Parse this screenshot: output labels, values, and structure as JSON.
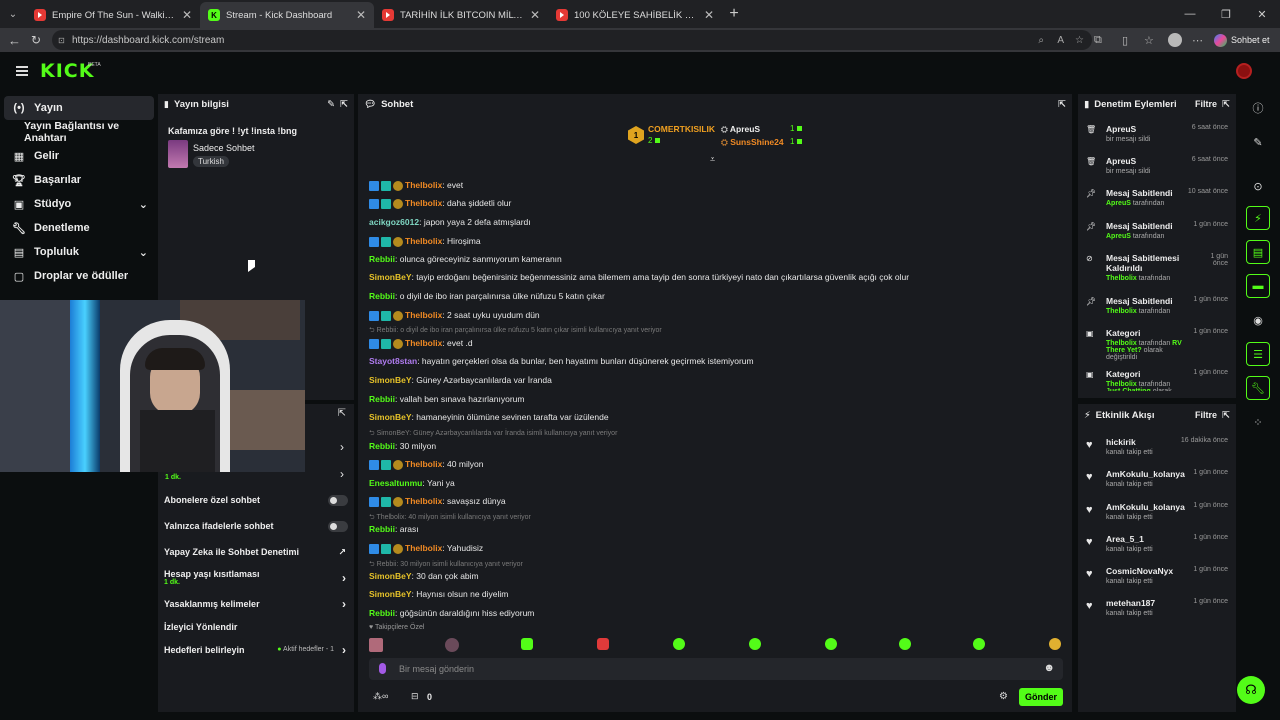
{
  "browser": {
    "tabs": [
      {
        "title": "Empire Of The Sun - Walking On A",
        "icon": "youtube-icon"
      },
      {
        "title": "Stream - Kick Dashboard",
        "icon": "kick-icon",
        "active": true
      },
      {
        "title": "TARİHİN İLK BITCOIN MİLYARDERİ",
        "icon": "youtube-icon"
      },
      {
        "title": "100 KÖLEYE SAHİBELİK YAPTIM! (S",
        "icon": "youtube-icon"
      }
    ],
    "url": "https://dashboard.kick.com/stream",
    "chat_btn": "Sohbet et"
  },
  "header": {
    "logo": "KICK",
    "beta": "BETA"
  },
  "sidebar": {
    "items": [
      {
        "label": "Yayın",
        "icon": "broadcast-icon"
      },
      {
        "label": "Yayın Bağlantısı ve Anahtarı",
        "icon": ""
      },
      {
        "label": "Gelir",
        "icon": "dashboard-icon"
      },
      {
        "label": "Başarılar",
        "icon": "trophy-icon"
      },
      {
        "label": "Stüdyo",
        "icon": "studio-icon"
      },
      {
        "label": "Denetleme",
        "icon": "wrench-icon"
      },
      {
        "label": "Topluluk",
        "icon": "community-icon"
      },
      {
        "label": "Droplar ve ödüller",
        "icon": "gift-icon"
      }
    ]
  },
  "stream_info": {
    "title": "Yayın bilgisi",
    "stream_title": "Kafamıza göre ! !yt !insta !bng",
    "category": "Sadece Sohbet",
    "language": "Turkish"
  },
  "chat_settings": {
    "time1": "1 dk.",
    "sub_only": "Abonelere özel sohbet",
    "emote_only": "Yalnızca ifadelerle sohbet",
    "ai_mod": "Yapay Zeka ile Sohbet Denetimi",
    "age": "Hesap yaşı kısıtlaması",
    "age_val": "1 dk.",
    "banned": "Yasaklanmış kelimeler",
    "raid": "İzleyici Yönlendir",
    "goals": "Hedefleri belirleyin",
    "goals_status": "Aktif hedefler - 1"
  },
  "chat": {
    "title": "Sohbet",
    "leader1": {
      "name": "COMERTKISILIK",
      "count": "2",
      "rank": "1"
    },
    "leader2": {
      "name": "ApreuS",
      "count": "1"
    },
    "leader3": {
      "name": "SunsShine24",
      "count": "1"
    },
    "followers_label": "Takipçilere Özel",
    "placeholder": "Bir mesaj gönderin",
    "send": "Gönder",
    "points": "0",
    "messages": [
      {
        "user": "Thelbolix",
        "color": "#f08a24",
        "text": "evet",
        "badges": true
      },
      {
        "user": "Thelbolix",
        "color": "#f08a24",
        "text": "daha şiddetli olur",
        "badges": true
      },
      {
        "user": "acikgoz6012",
        "color": "#7fd6c2",
        "text": "japon yaya 2 defa atmışlardı",
        "badges": false
      },
      {
        "user": "Thelbolix",
        "color": "#f08a24",
        "text": "Hiroşima",
        "badges": true
      },
      {
        "user": "Rebbii",
        "color": "#53fc18",
        "text": "olunca göreceyiniz sanmıyorum kameranın",
        "badges": false
      },
      {
        "user": "SimonBeY",
        "color": "#e6c229",
        "text": "tayip erdoğanı beğenirsiniz beğenmessiniz ama bilemem ama tayip den sonra türkiyeyi nato dan çıkartılarsa güvenlik açığı çok olur",
        "badges": false
      },
      {
        "user": "Rebbii",
        "color": "#53fc18",
        "text": "o diyil de ibo iran parçalınırsa ülke nüfuzu 5 katın çıkar",
        "badges": false
      },
      {
        "user": "Thelbolix",
        "color": "#f08a24",
        "text": "2 saat uyku uyudum dün",
        "badges": true
      },
      {
        "reply": "Rebbii: o diyil de ibo iran parçalınırsa ülke nüfuzu 5 katın çıkar isimli kullanıcıya yanıt veriyor"
      },
      {
        "user": "Thelbolix",
        "color": "#f08a24",
        "text": "evet .d",
        "badges": true
      },
      {
        "user": "Stayot8stan",
        "color": "#b07cf0",
        "text": "hayatın gerçekleri olsa da bunlar, ben hayatımı bunları düşünerek geçirmek istemiyorum",
        "badges": false
      },
      {
        "user": "SimonBeY",
        "color": "#e6c229",
        "text": "Güney Azərbaycanlılarda var İranda",
        "badges": false
      },
      {
        "user": "Rebbii",
        "color": "#53fc18",
        "text": "vallah ben sınava hazırlanıyorum",
        "badges": false
      },
      {
        "user": "SimonBeY",
        "color": "#e6c229",
        "text": "hamaneyinin ölümüne sevinen tarafta var üzülende",
        "badges": false
      },
      {
        "reply": "SimonBeY: Güney Azərbaycanlılarda var İranda isimli kullanıcıya yanıt veriyor"
      },
      {
        "user": "Rebbii",
        "color": "#53fc18",
        "text": "30 milyon",
        "badges": false
      },
      {
        "user": "Thelbolix",
        "color": "#f08a24",
        "text": "40 milyon",
        "badges": true
      },
      {
        "user": "Enesaltunmu",
        "color": "#53fc18",
        "text": "Yani ya",
        "badges": false
      },
      {
        "user": "Thelbolix",
        "color": "#f08a24",
        "text": "savaşsız dünya",
        "badges": true
      },
      {
        "reply": "Thelbolix: 40 milyon isimli kullanıcıya yanıt veriyor"
      },
      {
        "user": "Rebbii",
        "color": "#53fc18",
        "text": "arası",
        "badges": false
      },
      {
        "user": "Thelbolix",
        "color": "#f08a24",
        "text": "Yahudisiz",
        "badges": true
      },
      {
        "reply": "Rebbii: 30 milyon isimli kullanıcıya yanıt veriyor"
      },
      {
        "user": "SimonBeY",
        "color": "#e6c229",
        "text": "30 dan çok abim",
        "badges": false
      },
      {
        "user": "SimonBeY",
        "color": "#e6c229",
        "text": "Haynısı olsun ne diyelim",
        "badges": false
      },
      {
        "user": "Rebbii",
        "color": "#53fc18",
        "text": "göğsünün daraldığını hiss ediyorum",
        "badges": false
      }
    ]
  },
  "mod_actions": {
    "title": "Denetim Eylemleri",
    "filter": "Filtre",
    "items": [
      {
        "icon": "trash-icon",
        "name": "ApreuS",
        "sub": "bir mesajı sildi",
        "time": "6 saat önce"
      },
      {
        "icon": "trash-icon",
        "name": "ApreuS",
        "sub": "bir mesajı sildi",
        "time": "6 saat önce"
      },
      {
        "icon": "pin-icon",
        "name": "Mesaj Sabitlendi",
        "user": "ApreuS",
        "sub": "tarafından",
        "time": "10 saat önce"
      },
      {
        "icon": "pin-icon",
        "name": "Mesaj Sabitlendi",
        "user": "ApreuS",
        "sub": "tarafından",
        "time": "1 gün önce"
      },
      {
        "icon": "unpin-icon",
        "name": "Mesaj Sabitlemesi Kaldırıldı",
        "user": "Thelbolix",
        "sub": "tarafından",
        "time": "1 gün önce"
      },
      {
        "icon": "pin-icon",
        "name": "Mesaj Sabitlendi",
        "user": "Thelbolix",
        "sub": "tarafından",
        "time": "1 gün önce"
      },
      {
        "icon": "category-icon",
        "name": "Kategori",
        "user": "Thelbolix",
        "sub": "tarafından",
        "extra": "RV There Yet?",
        "sub2": "olarak değiştirildi",
        "time": "1 gün önce"
      },
      {
        "icon": "category-icon",
        "name": "Kategori",
        "user": "Thelbolix",
        "sub": "tarafından",
        "extra": "Just Chatting",
        "sub2": "olarak değiştirildi",
        "time": "1 gün önce"
      }
    ]
  },
  "activity": {
    "title": "Etkinlik Akışı",
    "filter": "Filtre",
    "items": [
      {
        "name": "hickirik",
        "sub": "kanalı takip etti",
        "time": "16 dakika önce"
      },
      {
        "name": "AmKokulu_kolanya",
        "sub": "kanalı takip etti",
        "time": "1 gün önce"
      },
      {
        "name": "AmKokulu_kolanya",
        "sub": "kanalı takip etti",
        "time": "1 gün önce"
      },
      {
        "name": "Area_5_1",
        "sub": "kanalı takip etti",
        "time": "1 gün önce"
      },
      {
        "name": "CosmicNovaNyx",
        "sub": "kanalı takip etti",
        "time": "1 gün önce"
      },
      {
        "name": "metehan187",
        "sub": "kanalı takip etti",
        "time": "1 gün önce"
      }
    ]
  },
  "colors": {
    "accent": "#53fc18",
    "panel": "#191b1f",
    "bg": "#0b0e0f"
  }
}
